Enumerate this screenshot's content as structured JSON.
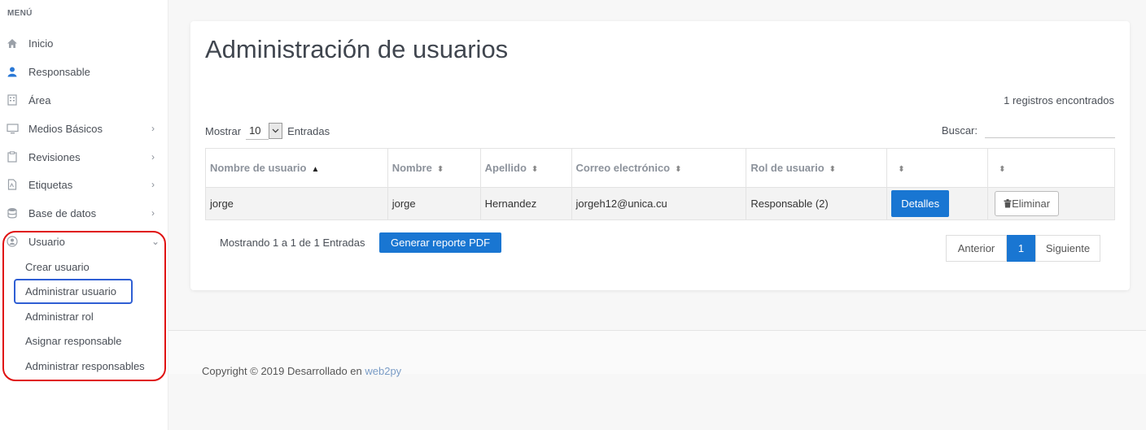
{
  "sidebar": {
    "menu_title": "MENÚ",
    "items": [
      {
        "label": "Inicio",
        "icon": "home-icon"
      },
      {
        "label": "Responsable",
        "icon": "user-icon"
      },
      {
        "label": "Área",
        "icon": "building-icon"
      },
      {
        "label": "Medios Básicos",
        "icon": "monitor-icon",
        "chevron": "›"
      },
      {
        "label": "Revisiones",
        "icon": "clipboard-icon",
        "chevron": "›"
      },
      {
        "label": "Etiquetas",
        "icon": "file-icon",
        "chevron": "›"
      },
      {
        "label": "Base de datos",
        "icon": "database-icon",
        "chevron": "›"
      },
      {
        "label": "Usuario",
        "icon": "user-circle-icon",
        "chevron": "⌄"
      }
    ],
    "sub_items": [
      {
        "label": "Crear usuario"
      },
      {
        "label": "Administrar usuario",
        "active": true
      },
      {
        "label": "Administrar rol"
      },
      {
        "label": "Asignar responsable"
      },
      {
        "label": "Administrar responsables"
      }
    ]
  },
  "main": {
    "title": "Administración de usuarios",
    "records_found": "1 registros encontrados",
    "show_label": "Mostrar",
    "show_value": "10",
    "entries_label": "Entradas",
    "search_label": "Buscar:",
    "search_value": "",
    "table": {
      "headers": [
        "Nombre de usuario",
        "Nombre",
        "Apellido",
        "Correo electrónico",
        "Rol de usuario",
        "",
        ""
      ],
      "rows": [
        {
          "username": "jorge",
          "name": "jorge",
          "surname": "Hernandez",
          "email": "jorgeh12@unica.cu",
          "role": "Responsable (2)",
          "details_label": "Detalles",
          "delete_label": "Eliminar"
        }
      ]
    },
    "showing_text": "Mostrando 1 a 1 de 1 Entradas",
    "pdf_button": "Generar reporte PDF",
    "pagination": {
      "prev": "Anterior",
      "current": "1",
      "next": "Siguiente"
    }
  },
  "footer": {
    "text": "Copyright © 2019 Desarrollado en",
    "link": "web2py"
  },
  "colors": {
    "accent": "#1976d2",
    "highlight_outline": "#e01010",
    "active_outline": "#2f5fd4"
  }
}
